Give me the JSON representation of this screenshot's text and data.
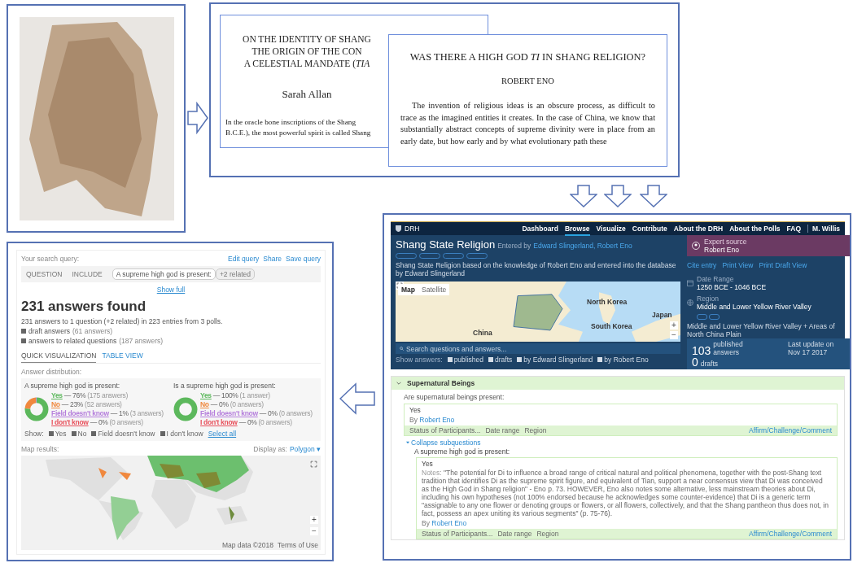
{
  "documents": [
    {
      "title_lines": [
        "ON THE IDENTITY OF SHANG",
        "THE ORIGIN OF THE CON",
        "A CELESTIAL MANDATE (*TIA*"
      ],
      "author": "Sarah Allan",
      "body_lines": [
        "In the oracle bone inscriptions of the Shang",
        "B.C.E.), the most powerful spirit is called Shang"
      ]
    },
    {
      "title_lines": [
        "WAS THERE A HIGH GOD *TI* IN SHANG RELIGION?"
      ],
      "author": "ROBERT ENO",
      "body_lines": [
        "The invention of religious ideas is an obscure process, as difficult to trace as the imagined entities it creates. In the case of China, we know that substantially abstract concepts of supreme divinity were in place from an early date, but how early and by what evolutionary path these"
      ]
    }
  ],
  "entry_page": {
    "logo": "DRH",
    "nav": [
      {
        "label": "Dashboard",
        "selected": false
      },
      {
        "label": "Browse",
        "selected": true
      },
      {
        "label": "Visualize",
        "selected": false
      },
      {
        "label": "Contribute",
        "selected": false
      },
      {
        "label": "About the DRH",
        "selected": false
      },
      {
        "label": "About the Polls",
        "selected": false
      },
      {
        "label": "FAQ",
        "selected": false
      }
    ],
    "user": "M. Willis",
    "title": "Shang State Religion",
    "entered_by": "Entered by",
    "authors": "Edward Slingerland, Robert Eno",
    "description": "Shang State Religion based on the knowledge of Robert Eno and entered into the database by Edward Slingerland",
    "expert": {
      "label": "Expert source",
      "name": "Robert Eno"
    },
    "actions": [
      "Cite entry",
      "Print View",
      "Print Draft View"
    ],
    "date": {
      "label": "Date Range",
      "value": "1250 BCE - 1046 BCE"
    },
    "region": {
      "label": "Region",
      "value": "Middle and Lower Yellow River Valley",
      "note": "Middle and Lower Yellow River Valley + Areas of North China Plain"
    },
    "map": {
      "tabs": [
        {
          "label": "Map",
          "selected": true
        },
        {
          "label": "Satellite",
          "selected": false
        }
      ],
      "labels": [
        "China",
        "North Korea",
        "South Korea",
        "Japan"
      ],
      "zoom": [
        "+",
        "−"
      ]
    },
    "search": {
      "placeholder": "Search questions and answers..."
    },
    "show_label": "Show answers:",
    "filters": [
      {
        "label": "published",
        "checked": true
      },
      {
        "label": "drafts",
        "checked": true
      },
      {
        "label": "by Edward Slingerland",
        "checked": true
      },
      {
        "label": "by Robert Eno",
        "checked": true
      }
    ],
    "stats": [
      {
        "value": "103",
        "label": "published answers"
      },
      {
        "value": "0",
        "label": "drafts"
      }
    ],
    "last_update": "Last update on Nov 17 2017",
    "section": {
      "title": "Supernatural Beings",
      "expanded": true,
      "question": "Are supernatural beings present:",
      "answer": "Yes",
      "by": "By",
      "author": "Robert Eno",
      "footer": [
        "Status of Participants...",
        "Date range",
        "Region"
      ],
      "footer_link": "Affirm/Challenge/Comment",
      "collapse": "Collapse subquestions",
      "subquestion": "A supreme high god is present:",
      "sub_answer": "Yes",
      "notes_label": "Notes:",
      "notes": "\"The potential for Di to influence a broad range of critical natural and political phenomena, together with the post-Shang text tradition that identifies Di as the supreme spirit figure, and equivalent of Tian, support a near consensus view that Di was conceived as the High God in Shang religion\" - Eno p. 73. HOWEVER, Eno also notes some alternative, less mainstream theories about Di, including his own hypotheses (not 100% endorsed because he acknowledges some counter-evidence) that Di is a generic term \"assignable to any one flower or denoting groups or flowers, or all flowers, collectively, and that the Shang pantheon thus does not, in fact, possess an apex uniting its various segments\" (p. 75-76).",
      "sub_by": "By",
      "sub_author": "Robert Eno",
      "sub_footer": [
        "Status of Participants...",
        "Date range",
        "Region"
      ],
      "sub_footer_link": "Affirm/Challenge/Comment"
    }
  },
  "results_page": {
    "query_label": "Your search query:",
    "query_actions": [
      "Edit query",
      "Share",
      "Save query"
    ],
    "query_row": {
      "field": "QUESTION",
      "mode": "INCLUDE",
      "chips": [
        "A supreme high god is present:",
        "+2 related"
      ]
    },
    "show_full": "Show full",
    "heading": "231 answers found",
    "summary": "231 answers to 1 question (+2 related) in 223 entries from 3 polls.",
    "options": [
      {
        "label": "draft answers",
        "count": "(61 answers)",
        "checked": true
      },
      {
        "label": "answers to related questions",
        "count": "(187 answers)",
        "checked": true
      }
    ],
    "tabs": [
      {
        "label": "QUICK VISUALIZATION",
        "selected": true
      },
      {
        "label": "TABLE VIEW",
        "selected": false
      }
    ],
    "distribution_label": "Answer distribution:",
    "distributions": [
      {
        "title": "A supreme high god is present:",
        "chart_data": {
          "type": "donut",
          "categories": [
            "Yes",
            "No",
            "Field doesn't know",
            "I don't know"
          ],
          "values": [
            76,
            23,
            1,
            0
          ]
        },
        "legend": [
          {
            "value": "— 76%",
            "count": "(175 answers)",
            "color": "#5cb85c"
          },
          {
            "value": "— 23%",
            "count": "(52 answers)",
            "color": "#f0883e"
          },
          {
            "value": "— 1%",
            "count": "(3 answers)",
            "color": "#b57edc"
          },
          {
            "value": "— 0%",
            "count": "(0 answers)",
            "color": "#e8505b"
          }
        ]
      },
      {
        "title": "Is a supreme high god is present:",
        "chart_data": {
          "type": "donut",
          "categories": [
            "Yes",
            "No",
            "Field doesn't know",
            "I don't know"
          ],
          "values": [
            100,
            0,
            0,
            0
          ]
        },
        "legend": [
          {
            "value": "— 100%",
            "count": "(1 answer)",
            "color": "#5cb85c"
          },
          {
            "value": "— 0%",
            "count": "(0 answers)",
            "color": "#f0883e"
          },
          {
            "value": "— 0%",
            "count": "(0 answers)",
            "color": "#b57edc"
          },
          {
            "value": "— 0%",
            "count": "(0 answers)",
            "color": "#e8505b"
          }
        ]
      }
    ],
    "show_label": "Show:",
    "show_filters": [
      {
        "label": "Yes",
        "checked": true
      },
      {
        "label": "No",
        "checked": true
      },
      {
        "label": "Field doesn't know",
        "checked": true
      },
      {
        "label": "I don't know",
        "checked": true
      }
    ],
    "select_all": "Select all",
    "map_label": "Map results:",
    "display_label": "Display as:",
    "display_value": "Polygon ▾",
    "map_zoom": [
      "+",
      "−"
    ],
    "map_credits": [
      "Map data ©2018",
      "Terms of Use"
    ]
  }
}
